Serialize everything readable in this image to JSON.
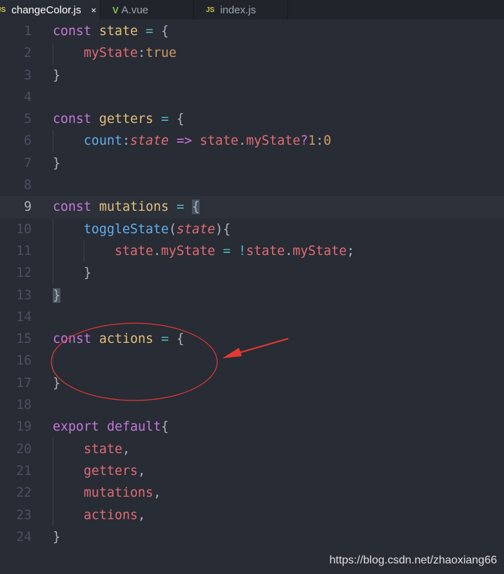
{
  "tabs": [
    {
      "label": "changeColor.js",
      "icon": "js-icon",
      "icon_text": "JS",
      "active": true,
      "close": "×"
    },
    {
      "label": "A.vue",
      "icon": "vue-icon",
      "icon_text": "V",
      "active": false
    },
    {
      "label": "index.js",
      "icon": "js-icon",
      "icon_text": "JS",
      "active": false
    }
  ],
  "current_line": 9,
  "lines": [
    {
      "n": "1",
      "indent": 0,
      "t": [
        [
          "const",
          "kw"
        ],
        [
          " ",
          ""
        ],
        [
          "state",
          "var"
        ],
        [
          " ",
          ""
        ],
        [
          "=",
          "op"
        ],
        [
          " ",
          ""
        ],
        [
          "{",
          "pun"
        ]
      ]
    },
    {
      "n": "2",
      "indent": 1,
      "t": [
        [
          "myState",
          "prop"
        ],
        [
          ":",
          "pun"
        ],
        [
          "true",
          "num"
        ]
      ]
    },
    {
      "n": "3",
      "indent": 0,
      "t": [
        [
          "}",
          "pun"
        ]
      ]
    },
    {
      "n": "4",
      "indent": 0,
      "t": []
    },
    {
      "n": "5",
      "indent": 0,
      "t": [
        [
          "const",
          "kw"
        ],
        [
          " ",
          ""
        ],
        [
          "getters",
          "var"
        ],
        [
          " ",
          ""
        ],
        [
          "=",
          "op"
        ],
        [
          " ",
          ""
        ],
        [
          "{",
          "pun"
        ]
      ]
    },
    {
      "n": "6",
      "indent": 1,
      "t": [
        [
          "count",
          "fn"
        ],
        [
          ":",
          "pun"
        ],
        [
          "state",
          "it"
        ],
        [
          " ",
          ""
        ],
        [
          "=>",
          "kw"
        ],
        [
          " ",
          ""
        ],
        [
          "state",
          "prop"
        ],
        [
          ".",
          "pun"
        ],
        [
          "myState",
          "prop"
        ],
        [
          "?",
          "kw"
        ],
        [
          "1",
          "num"
        ],
        [
          ":",
          "pun"
        ],
        [
          "0",
          "num"
        ]
      ]
    },
    {
      "n": "7",
      "indent": 0,
      "t": [
        [
          "}",
          "pun"
        ]
      ]
    },
    {
      "n": "8",
      "indent": 0,
      "t": []
    },
    {
      "n": "9",
      "indent": 0,
      "t": [
        [
          "const",
          "kw"
        ],
        [
          " ",
          ""
        ],
        [
          "mutations",
          "var"
        ],
        [
          " ",
          ""
        ],
        [
          "=",
          "op"
        ],
        [
          " ",
          ""
        ],
        [
          "{",
          "pun br"
        ]
      ]
    },
    {
      "n": "10",
      "indent": 1,
      "t": [
        [
          "toggleState",
          "fn"
        ],
        [
          "(",
          "pun"
        ],
        [
          "state",
          "it"
        ],
        [
          "){",
          "pun"
        ]
      ]
    },
    {
      "n": "11",
      "indent": 2,
      "t": [
        [
          "state",
          "prop"
        ],
        [
          ".",
          "pun"
        ],
        [
          "myState",
          "prop"
        ],
        [
          " ",
          ""
        ],
        [
          "=",
          "op"
        ],
        [
          " ",
          ""
        ],
        [
          "!",
          "op"
        ],
        [
          "state",
          "prop"
        ],
        [
          ".",
          "pun"
        ],
        [
          "myState",
          "prop"
        ],
        [
          ";",
          "pun"
        ]
      ]
    },
    {
      "n": "12",
      "indent": 1,
      "t": [
        [
          "}",
          "pun"
        ]
      ]
    },
    {
      "n": "13",
      "indent": 0,
      "t": [
        [
          "}",
          "pun br"
        ]
      ]
    },
    {
      "n": "14",
      "indent": 0,
      "t": []
    },
    {
      "n": "15",
      "indent": 0,
      "t": [
        [
          "const",
          "kw"
        ],
        [
          " ",
          ""
        ],
        [
          "actions",
          "var"
        ],
        [
          " ",
          ""
        ],
        [
          "=",
          "op"
        ],
        [
          " ",
          ""
        ],
        [
          "{",
          "pun"
        ]
      ]
    },
    {
      "n": "16",
      "indent": 0,
      "t": []
    },
    {
      "n": "17",
      "indent": 0,
      "t": [
        [
          "}",
          "pun"
        ]
      ]
    },
    {
      "n": "18",
      "indent": 0,
      "t": []
    },
    {
      "n": "19",
      "indent": 0,
      "t": [
        [
          "export",
          "kw"
        ],
        [
          " ",
          ""
        ],
        [
          "default",
          "kw"
        ],
        [
          "{",
          "pun"
        ]
      ]
    },
    {
      "n": "20",
      "indent": 1,
      "t": [
        [
          "state",
          "prop"
        ],
        [
          ",",
          "pun"
        ]
      ]
    },
    {
      "n": "21",
      "indent": 1,
      "t": [
        [
          "getters",
          "prop"
        ],
        [
          ",",
          "pun"
        ]
      ]
    },
    {
      "n": "22",
      "indent": 1,
      "t": [
        [
          "mutations",
          "prop"
        ],
        [
          ",",
          "pun"
        ]
      ]
    },
    {
      "n": "23",
      "indent": 1,
      "t": [
        [
          "actions",
          "prop"
        ],
        [
          ",",
          "pun"
        ]
      ]
    },
    {
      "n": "24",
      "indent": 0,
      "t": [
        [
          "}",
          "pun"
        ]
      ]
    }
  ],
  "annotation_color": "#e53935",
  "watermark": "https://blog.csdn.net/zhaoxiang66"
}
